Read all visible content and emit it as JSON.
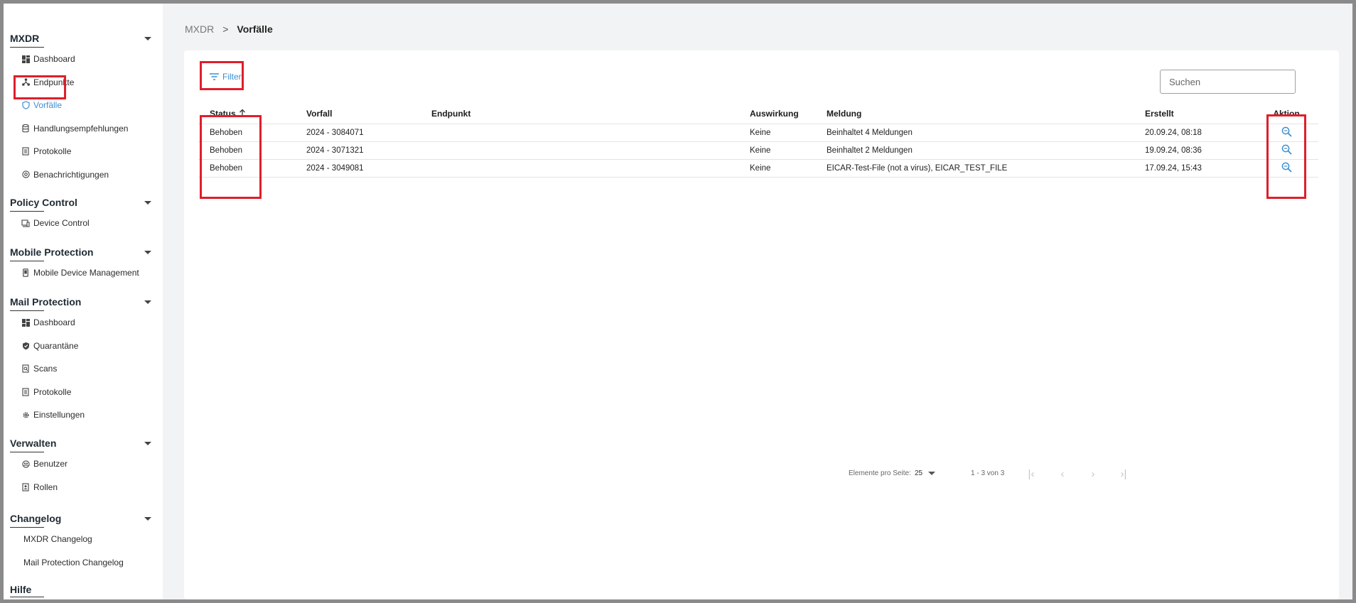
{
  "sidebar": {
    "sections": [
      {
        "title": "MXDR",
        "items": [
          {
            "label": "Dashboard",
            "icon": "dashboard-icon"
          },
          {
            "label": "Endpunkte",
            "icon": "network-icon"
          },
          {
            "label": "Vorfälle",
            "icon": "shield-icon",
            "active": true
          },
          {
            "label": "Handlungsempfehlungen",
            "icon": "database-icon"
          },
          {
            "label": "Protokolle",
            "icon": "document-icon"
          },
          {
            "label": "Benachrichtigungen",
            "icon": "at-sign-icon"
          }
        ]
      },
      {
        "title": "Policy Control",
        "items": [
          {
            "label": "Device Control",
            "icon": "device-icon"
          }
        ]
      },
      {
        "title": "Mobile Protection",
        "items": [
          {
            "label": "Mobile Device Management",
            "icon": "phone-icon"
          }
        ]
      },
      {
        "title": "Mail Protection",
        "items": [
          {
            "label": "Dashboard",
            "icon": "dashboard-icon"
          },
          {
            "label": "Quarantäne",
            "icon": "shield-check-icon"
          },
          {
            "label": "Scans",
            "icon": "scan-icon"
          },
          {
            "label": "Protokolle",
            "icon": "document-icon"
          },
          {
            "label": "Einstellungen",
            "icon": "gear-icon"
          }
        ]
      },
      {
        "title": "Verwalten",
        "items": [
          {
            "label": "Benutzer",
            "icon": "users-icon"
          },
          {
            "label": "Rollen",
            "icon": "id-card-icon"
          }
        ]
      },
      {
        "title": "Changelog",
        "items": [
          {
            "label": "MXDR Changelog"
          },
          {
            "label": "Mail Protection Changelog"
          }
        ]
      },
      {
        "title": "Hilfe",
        "items": []
      }
    ]
  },
  "breadcrumb": {
    "root": "MXDR",
    "separator": ">",
    "current": "Vorfälle"
  },
  "toolbar": {
    "filter_label": "Filter",
    "search_placeholder": "Suchen"
  },
  "table": {
    "headers": {
      "status": "Status",
      "vorfall": "Vorfall",
      "endpunkt": "Endpunkt",
      "auswirkung": "Auswirkung",
      "meldung": "Meldung",
      "erstellt": "Erstellt",
      "aktion": "Aktion"
    },
    "rows": [
      {
        "status": "Behoben",
        "vorfall": "2024 - 3084071",
        "endpunkt": "",
        "auswirkung": "Keine",
        "meldung": "Beinhaltet 4 Meldungen",
        "erstellt": "20.09.24, 08:18"
      },
      {
        "status": "Behoben",
        "vorfall": "2024 - 3071321",
        "endpunkt": "",
        "auswirkung": "Keine",
        "meldung": "Beinhaltet 2 Meldungen",
        "erstellt": "19.09.24, 08:36"
      },
      {
        "status": "Behoben",
        "vorfall": "2024 - 3049081",
        "endpunkt": "",
        "auswirkung": "Keine",
        "meldung": "EICAR-Test-File (not a virus), EICAR_TEST_FILE",
        "erstellt": "17.09.24, 15:43"
      }
    ]
  },
  "pagination": {
    "page_size_label": "Elemente pro Seite:",
    "page_size": "25",
    "range": "1 - 3 von 3"
  },
  "colors": {
    "accent": "#3d8fd1",
    "highlight": "#e01e2b"
  }
}
